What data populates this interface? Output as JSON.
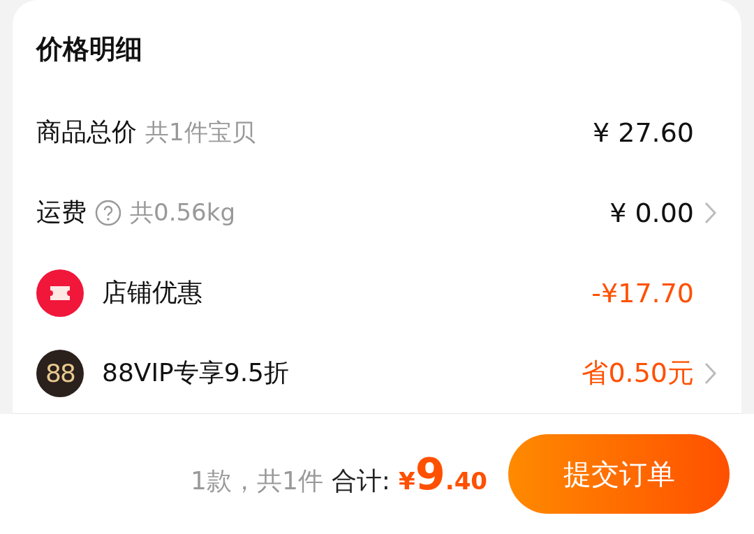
{
  "title": "价格明细",
  "rows": [
    {
      "label": "商品总价",
      "help": false,
      "note": "共1件宝贝",
      "value": "¥ 27.60",
      "accent": false,
      "chevron": false
    },
    {
      "label": "运费",
      "help": true,
      "note": "共0.56kg",
      "value": "¥ 0.00",
      "accent": false,
      "chevron": true
    },
    {
      "icon": {
        "kind": "coupon"
      },
      "label": "店铺优惠",
      "help": false,
      "value": "-¥17.70",
      "accent": true,
      "chevron": false
    },
    {
      "icon": {
        "kind": "vip",
        "text": "88"
      },
      "label": "88VIP专享9.5折",
      "help": false,
      "value": "省0.50元",
      "accent": true,
      "chevron": true
    }
  ],
  "footer": {
    "summary": "1款，共1件",
    "total_label": "合计:",
    "currency": "¥",
    "amount_int": "9",
    "amount_dec": ".40",
    "submit": "提交订单"
  }
}
